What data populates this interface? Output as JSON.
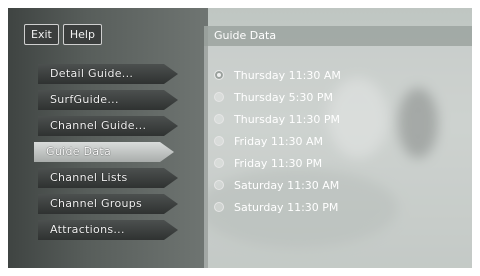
{
  "top_buttons": {
    "exit": "Exit",
    "help": "Help"
  },
  "menu": [
    "Detail Guide...",
    "SurfGuide...",
    "Channel Guide...",
    "Guide Data",
    "Channel Lists",
    "Channel Groups",
    "Attractions..."
  ],
  "selected_menu_item": "Guide Data",
  "panel": {
    "title": "Guide Data",
    "options": [
      "Thursday 11:30 AM",
      "Thursday 5:30 PM",
      "Thursday 11:30 PM",
      "Friday 11:30 AM",
      "Friday 11:30 PM",
      "Saturday 11:30 AM",
      "Saturday 11:30 PM"
    ],
    "selected_option": "Thursday 11:30 AM"
  }
}
